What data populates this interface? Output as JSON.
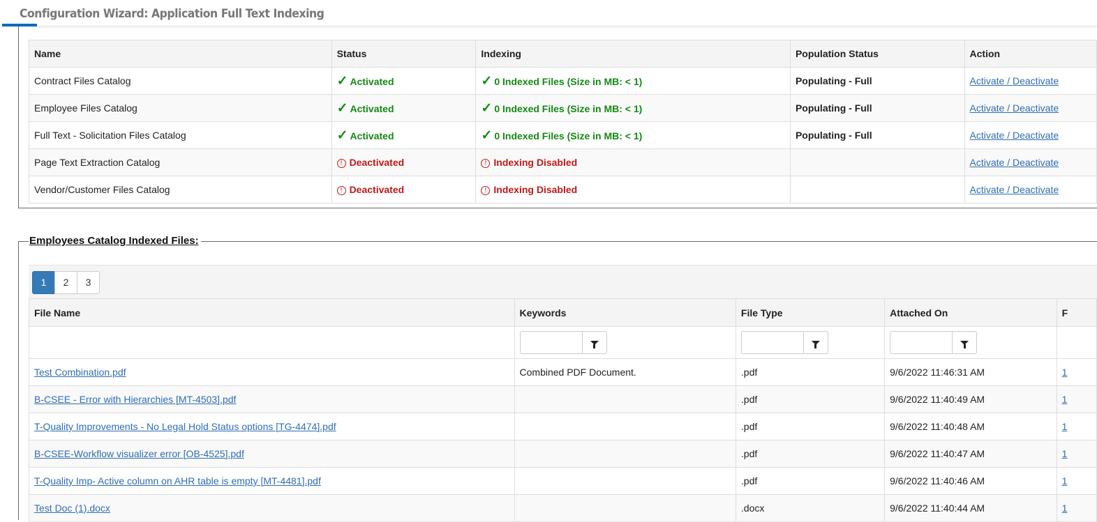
{
  "header": {
    "title": "Configuration Wizard: Application Full Text Indexing",
    "accent": "#0a6ac2"
  },
  "catalogs": {
    "columns": [
      "Name",
      "Status",
      "Indexing",
      "Population Status",
      "Action"
    ],
    "rows": [
      {
        "name": "Contract Files Catalog",
        "status": "Activated",
        "status_ok": true,
        "indexing": "0 Indexed Files (Size in MB: < 1)",
        "population": "Populating - Full",
        "action": "Activate / Deactivate"
      },
      {
        "name": "Employee Files Catalog",
        "status": "Activated",
        "status_ok": true,
        "indexing": "0 Indexed Files (Size in MB: < 1)",
        "population": "Populating - Full",
        "action": "Activate / Deactivate"
      },
      {
        "name": "Full Text - Solicitation Files Catalog",
        "status": "Activated",
        "status_ok": true,
        "indexing": "0 Indexed Files (Size in MB: < 1)",
        "population": "Populating - Full",
        "action": "Activate / Deactivate"
      },
      {
        "name": "Page Text Extraction Catalog",
        "status": "Deactivated",
        "status_ok": false,
        "indexing": "Indexing Disabled",
        "population": "",
        "action": "Activate / Deactivate"
      },
      {
        "name": "Vendor/Customer Files Catalog",
        "status": "Deactivated",
        "status_ok": false,
        "indexing": "Indexing Disabled",
        "population": "",
        "action": "Activate / Deactivate"
      }
    ]
  },
  "files": {
    "legend": "Employees Catalog Indexed Files:",
    "pages": [
      "1",
      "2",
      "3"
    ],
    "current_page": "1",
    "columns": [
      "File Name",
      "Keywords",
      "File Type",
      "Attached On",
      "F"
    ],
    "rows": [
      {
        "name": "Test Combination.pdf",
        "keywords": "Combined PDF Document.",
        "type": ".pdf",
        "attached": "9/6/2022 11:46:31 AM",
        "extra": "1"
      },
      {
        "name": "B-CSEE - Error with Hierarchies [MT-4503].pdf",
        "keywords": "",
        "type": ".pdf",
        "attached": "9/6/2022 11:40:49 AM",
        "extra": "1"
      },
      {
        "name": "T-Quality Improvements - No Legal Hold Status options [TG-4474].pdf",
        "keywords": "",
        "type": ".pdf",
        "attached": "9/6/2022 11:40:48 AM",
        "extra": "1"
      },
      {
        "name": "B-CSEE-Workflow visualizer error [OB-4525].pdf",
        "keywords": "",
        "type": ".pdf",
        "attached": "9/6/2022 11:40:47 AM",
        "extra": "1"
      },
      {
        "name": "T-Quality Imp- Active column on AHR table is empty [MT-4481].pdf",
        "keywords": "",
        "type": ".pdf",
        "attached": "9/6/2022 11:40:46 AM",
        "extra": "1"
      },
      {
        "name": "Test Doc (1).docx",
        "keywords": "",
        "type": ".docx",
        "attached": "9/6/2022 11:40:44 AM",
        "extra": "1"
      }
    ]
  }
}
